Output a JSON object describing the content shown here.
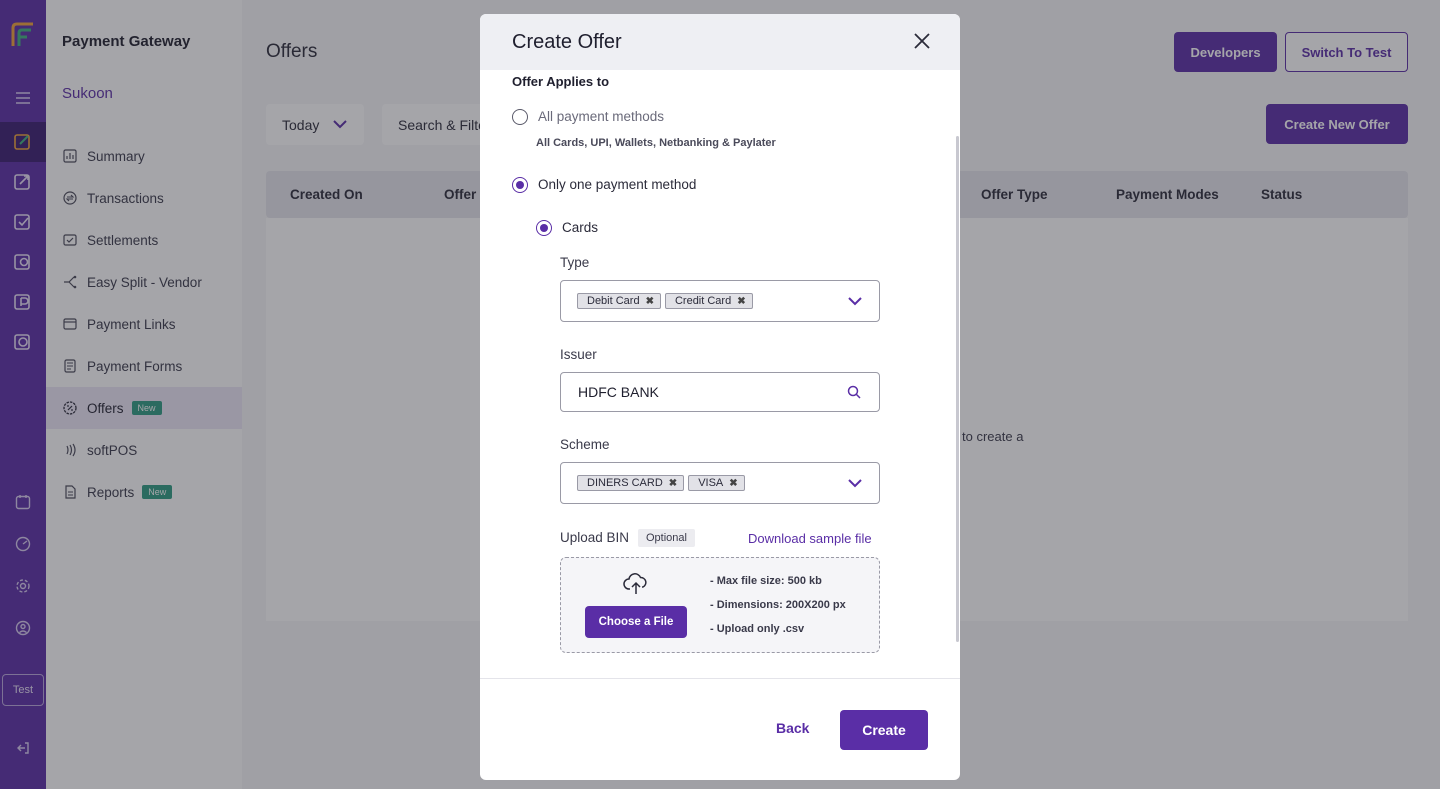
{
  "sidebar": {
    "title": "Payment Gateway",
    "merchant": "Sukoon",
    "items": [
      {
        "label": "Summary"
      },
      {
        "label": "Transactions"
      },
      {
        "label": "Settlements"
      },
      {
        "label": "Easy Split - Vendor"
      },
      {
        "label": "Payment Links"
      },
      {
        "label": "Payment Forms"
      },
      {
        "label": "Offers",
        "badge": "New"
      },
      {
        "label": "softPOS"
      },
      {
        "label": "Reports",
        "badge": "New"
      }
    ]
  },
  "rail": {
    "test_label": "Test"
  },
  "header": {
    "title": "Offers",
    "developers_label": "Developers",
    "switch_label": "Switch To Test",
    "create_new_offer_label": "Create New Offer"
  },
  "filters": {
    "date_value": "Today",
    "search_placeholder": "Search & Filte"
  },
  "table": {
    "columns": [
      "Created On",
      "Offer",
      "Offer Type",
      "Payment Modes",
      "Status"
    ],
    "empty_fragment": "to create a"
  },
  "modal": {
    "title": "Create Offer",
    "section_label": "Offer Applies to",
    "option_all": "All payment methods",
    "option_all_note": "All Cards, UPI, Wallets, Netbanking & Paylater",
    "option_one": "Only one payment method",
    "option_cards": "Cards",
    "type_label": "Type",
    "type_chips": [
      "Debit Card",
      "Credit Card"
    ],
    "issuer_label": "Issuer",
    "issuer_value": "HDFC BANK",
    "scheme_label": "Scheme",
    "scheme_chips": [
      "DINERS CARD",
      "VISA"
    ],
    "upload_label": "Upload BIN",
    "optional_label": "Optional",
    "download_label": "Download sample file",
    "choose_file_label": "Choose a File",
    "requirements": [
      "- Max file size: 500 kb",
      "- Dimensions: 200X200 px",
      "- Upload only .csv"
    ],
    "back_label": "Back",
    "create_label": "Create"
  },
  "colors": {
    "brand": "#5a2ea6",
    "badge": "#2e9c82"
  }
}
